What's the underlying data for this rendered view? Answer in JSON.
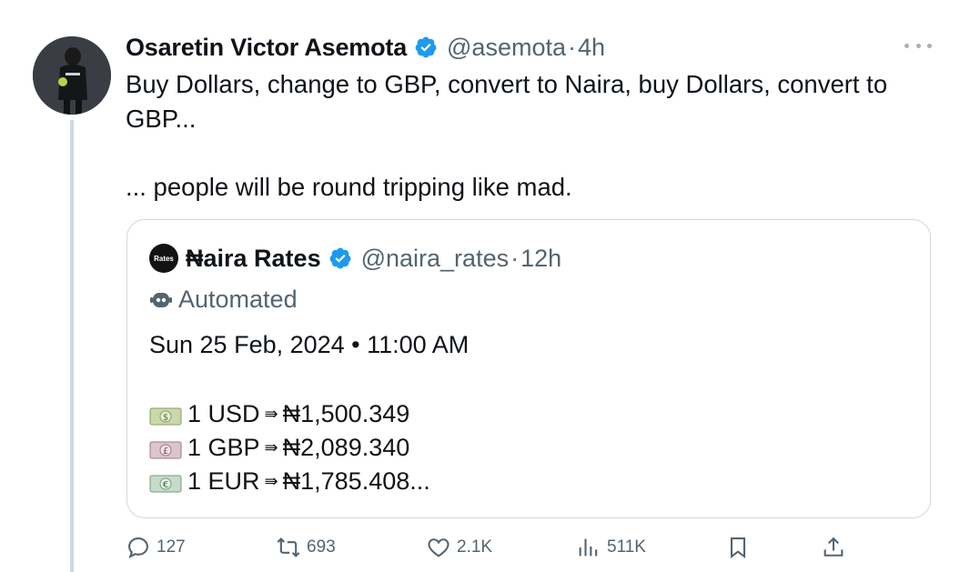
{
  "tweet": {
    "author": {
      "display_name": "Osaretin Victor Asemota",
      "handle": "@asemota",
      "time": "4h",
      "verified": true
    },
    "text_line1": "Buy Dollars, change to GBP, convert to Naira, buy Dollars, convert to GBP...",
    "text_line2": "... people will be round tripping like mad.",
    "more_icon": "more-horizontal-icon"
  },
  "quote": {
    "avatar_text": "Rates",
    "display_name": "₦aira Rates",
    "handle": "@naira_rates",
    "time": "12h",
    "automated_label": "Automated",
    "date": "Sun 25 Feb, 2024 • 11:00 AM",
    "rates": [
      {
        "icon": "dollar-banknote-icon",
        "currency": "1 USD",
        "arrow": "⇛",
        "value": "₦1,500.349"
      },
      {
        "icon": "pound-banknote-icon",
        "currency": "1 GBP",
        "arrow": "⇛",
        "value": "₦2,089.340"
      },
      {
        "icon": "euro-banknote-icon",
        "currency": "1 EUR",
        "arrow": "⇛",
        "value": "₦1,785.408..."
      }
    ]
  },
  "actions": {
    "replies": "127",
    "reposts": "693",
    "likes": "2.1K",
    "views": "511K"
  },
  "colors": {
    "text": "#0f1419",
    "secondary": "#536471",
    "verified": "#1d9bf0",
    "border": "#cfd9de"
  }
}
